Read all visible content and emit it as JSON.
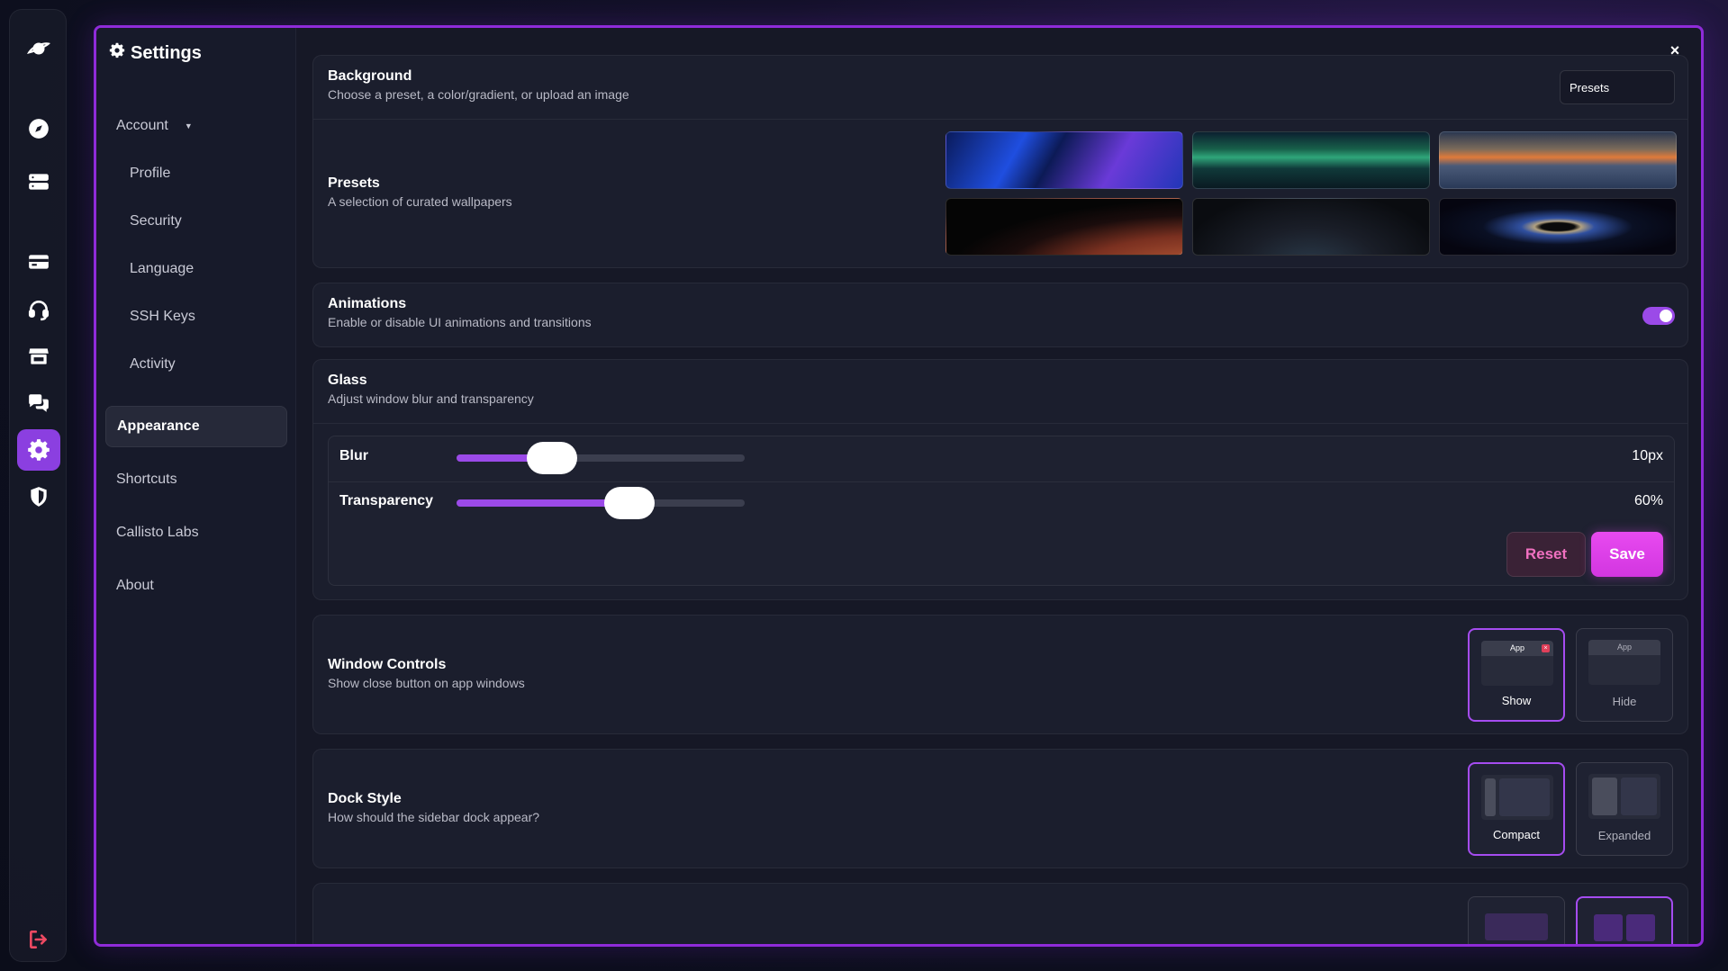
{
  "dock": {
    "items": [
      {
        "name": "planet-icon"
      },
      {
        "name": "compass-icon"
      },
      {
        "name": "server-icon"
      },
      {
        "name": "card-icon"
      },
      {
        "name": "headset-icon"
      },
      {
        "name": "store-icon"
      },
      {
        "name": "chat-icon"
      },
      {
        "name": "gear-icon",
        "active": true
      },
      {
        "name": "shield-icon"
      },
      {
        "name": "logout-icon"
      }
    ]
  },
  "window": {
    "close_label": "×"
  },
  "sidebar": {
    "title": "Settings",
    "account": "Account",
    "items": [
      "Profile",
      "Security",
      "Language",
      "SSH Keys",
      "Activity"
    ],
    "appearance": "Appearance",
    "shortcuts": "Shortcuts",
    "callisto": "Callisto Labs",
    "about": "About"
  },
  "background": {
    "title": "Background",
    "desc": "Choose a preset, a color/gradient, or upload an image",
    "select_value": "Presets",
    "presets_title": "Presets",
    "presets_desc": "A selection of curated wallpapers"
  },
  "animations": {
    "title": "Animations",
    "desc": "Enable or disable UI animations and transitions",
    "enabled": true
  },
  "glass": {
    "title": "Glass",
    "desc": "Adjust window blur and transparency",
    "blur_label": "Blur",
    "blur_value": "10px",
    "blur_fraction": 0.33,
    "transparency_label": "Transparency",
    "transparency_value": "60%",
    "transparency_fraction": 0.6,
    "reset_label": "Reset",
    "save_label": "Save"
  },
  "window_controls": {
    "title": "Window Controls",
    "desc": "Show close button on app windows",
    "show_label": "Show",
    "hide_label": "Hide",
    "app_label": "App",
    "selected": "Show"
  },
  "dock_style": {
    "title": "Dock Style",
    "desc": "How should the sidebar dock appear?",
    "compact_label": "Compact",
    "expanded_label": "Expanded",
    "selected": "Compact"
  },
  "colors": {
    "accent": "#9b4ae8",
    "window_border": "#8f2bd9",
    "save": "#e84af0",
    "logout": "#ef4a63"
  }
}
